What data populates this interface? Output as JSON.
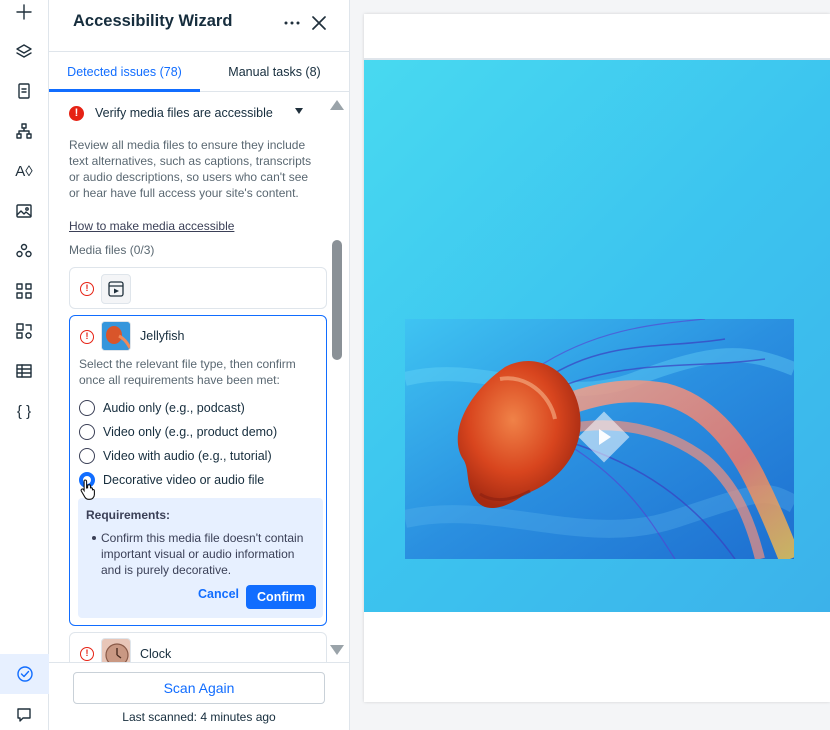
{
  "panel": {
    "title": "Accessibility Wizard",
    "tabs": [
      {
        "label": "Detected issues (78)",
        "active": true
      },
      {
        "label": "Manual tasks (8)",
        "active": false
      }
    ]
  },
  "issue": {
    "title": "Verify media files are accessible",
    "description": "Review all media files to ensure they include text alternatives, such as captions, transcripts or audio descriptions, so users who can't see or hear have full access your site's content.",
    "link": "How to make media accessible",
    "media_files_label": "Media files (0/3)"
  },
  "media": {
    "first_item_icon": "video-file-icon",
    "jellyfish": {
      "name": "Jellyfish",
      "instruction": "Select the relevant file type, then confirm once all requirements have been met:",
      "options": [
        {
          "label": "Audio only (e.g., podcast)",
          "checked": false
        },
        {
          "label": "Video only (e.g., product demo)",
          "checked": false
        },
        {
          "label": "Video with audio (e.g., tutorial)",
          "checked": false
        },
        {
          "label": "Decorative video or audio file",
          "checked": true
        }
      ],
      "requirements": {
        "title": "Requirements:",
        "text": "Confirm this media file doesn't contain important visual or audio information and is purely decorative.",
        "cancel": "Cancel",
        "confirm": "Confirm"
      }
    },
    "clock": {
      "name": "Clock"
    }
  },
  "footer": {
    "scan_again": "Scan Again",
    "last_scanned": "Last scanned: 4 minutes ago"
  },
  "colors": {
    "accent": "#116dff",
    "error": "#e62214"
  }
}
